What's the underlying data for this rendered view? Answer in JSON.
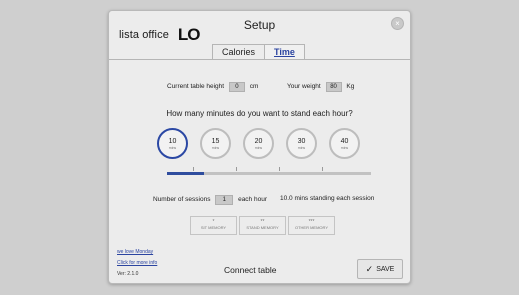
{
  "header": {
    "logo_text": "lista office",
    "logo_mark": "LO",
    "title": "Setup",
    "close_icon": "close-icon"
  },
  "tabs": [
    {
      "label": "Calories",
      "active": false
    },
    {
      "label": "Time",
      "active": true
    }
  ],
  "height": {
    "label": "Current table height",
    "value": "0",
    "unit": "cm"
  },
  "weight": {
    "label": "Your weight",
    "value": "80",
    "unit": "Kg"
  },
  "question": "How many minutes do you want to stand each hour?",
  "minutes_options": [
    {
      "value": "10",
      "unit": "mins",
      "selected": true
    },
    {
      "value": "15",
      "unit": "mins",
      "selected": false
    },
    {
      "value": "20",
      "unit": "mins",
      "selected": false
    },
    {
      "value": "30",
      "unit": "mins",
      "selected": false
    },
    {
      "value": "40",
      "unit": "mins",
      "selected": false
    }
  ],
  "slider": {
    "fraction": 0.18
  },
  "sessions": {
    "label": "Number of sessions",
    "value": "1",
    "unit": "each hour",
    "summary": "10.0 mins standing each session"
  },
  "memory": [
    {
      "stars": "*",
      "label": "SIT MEMORY"
    },
    {
      "stars": "**",
      "label": "STAND MEMORY"
    },
    {
      "stars": "***",
      "label": "OTHER MEMORY"
    }
  ],
  "footer": {
    "link1": "we love Monday",
    "link2": "Click for more info",
    "version": "Ver: 2.1.0",
    "connect": "Connect table",
    "save": "SAVE"
  },
  "colors": {
    "accent": "#2b48a4",
    "link": "#2b44a0"
  }
}
